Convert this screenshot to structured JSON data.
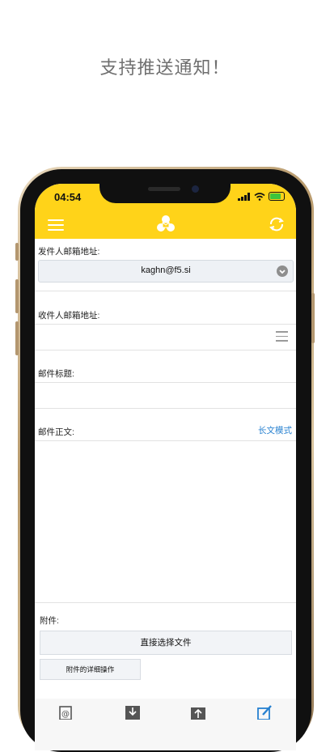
{
  "tagline": "支持推送通知！",
  "status_bar": {
    "time": "04:54"
  },
  "icons": {
    "menu": "hamburger-menu-icon",
    "logo": "recycle-mail-logo-icon",
    "refresh": "refresh-icon",
    "dropdown": "chevron-down-icon",
    "recipients_list": "list-icon",
    "tabs": [
      "contacts-icon",
      "inbox-download-icon",
      "outbox-upload-icon",
      "compose-icon"
    ]
  },
  "colors": {
    "header": "#ffd319",
    "link": "#2680d0",
    "battery": "#3cc43c"
  },
  "form": {
    "from_label": "发件人邮箱地址:",
    "from_value": "kaghn@f5.si",
    "to_label": "收件人邮箱地址:",
    "subject_label": "邮件标题:",
    "body_label": "邮件正文:",
    "long_mode": "长文模式",
    "attachment_label": "附件:",
    "pick_file_button": "直接选择文件",
    "attachment_detail_button": "附件的详细操作"
  }
}
